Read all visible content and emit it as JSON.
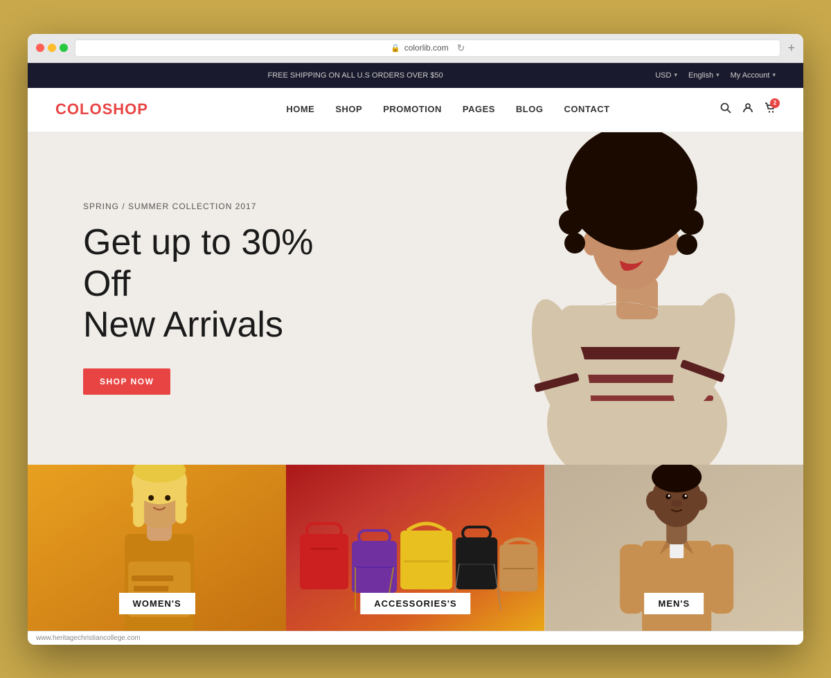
{
  "browser": {
    "url": "colorlib.com",
    "add_tab_label": "+"
  },
  "top_bar": {
    "message": "FREE SHIPPING ON ALL U.S ORDERS OVER $50",
    "currency": "USD",
    "language": "English",
    "account": "My Account",
    "currency_chevron": "▾",
    "language_chevron": "▾",
    "account_chevron": "▾"
  },
  "nav": {
    "logo_part1": "COLO",
    "logo_part2": "SHOP",
    "links": [
      {
        "label": "HOME"
      },
      {
        "label": "SHOP"
      },
      {
        "label": "PROMOTION"
      },
      {
        "label": "PAGES"
      },
      {
        "label": "BLOG"
      },
      {
        "label": "CONTACT"
      }
    ],
    "cart_count": "2"
  },
  "hero": {
    "subtitle": "SPRING / SUMMER COLLECTION 2017",
    "title_line1": "Get up to 30% Off",
    "title_line2": "New Arrivals",
    "cta_label": "SHOP NOW"
  },
  "categories": [
    {
      "id": "womens",
      "label": "WOMEN'S"
    },
    {
      "id": "accessories",
      "label": "ACCESSORIES'S"
    },
    {
      "id": "mens",
      "label": "MEN'S"
    }
  ],
  "status_bar": {
    "url": "www.heritagechristiancollege.com"
  }
}
